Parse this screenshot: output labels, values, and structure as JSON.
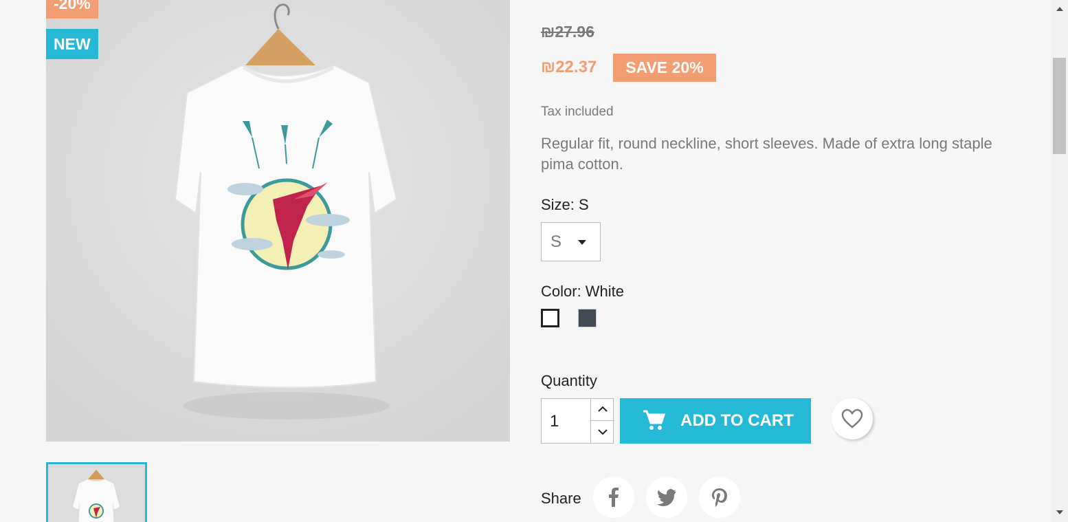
{
  "product": {
    "discount_flag": "-20%",
    "new_flag": "NEW",
    "old_price": "₪27.96",
    "price": "₪22.37",
    "save_badge": "SAVE 20%",
    "tax_note": "Tax included",
    "description": "Regular fit, round neckline, short sleeves. Made of extra long staple pima cotton.",
    "colors": {
      "accent": "#24b9d7",
      "discount": "#f39d72",
      "swatch_white": "#ffffff",
      "swatch_grey": "#434a54"
    }
  },
  "size": {
    "label": "Size: S",
    "selected": "S"
  },
  "color": {
    "label": "Color: White",
    "options": [
      "White",
      "Grey"
    ]
  },
  "quantity": {
    "label": "Quantity",
    "value": "1"
  },
  "cart": {
    "add_label": "ADD TO CART",
    "icon": "shopping-cart-icon"
  },
  "wishlist": {
    "icon": "heart-icon"
  },
  "share": {
    "label": "Share",
    "networks": [
      "facebook",
      "twitter",
      "pinterest"
    ]
  }
}
